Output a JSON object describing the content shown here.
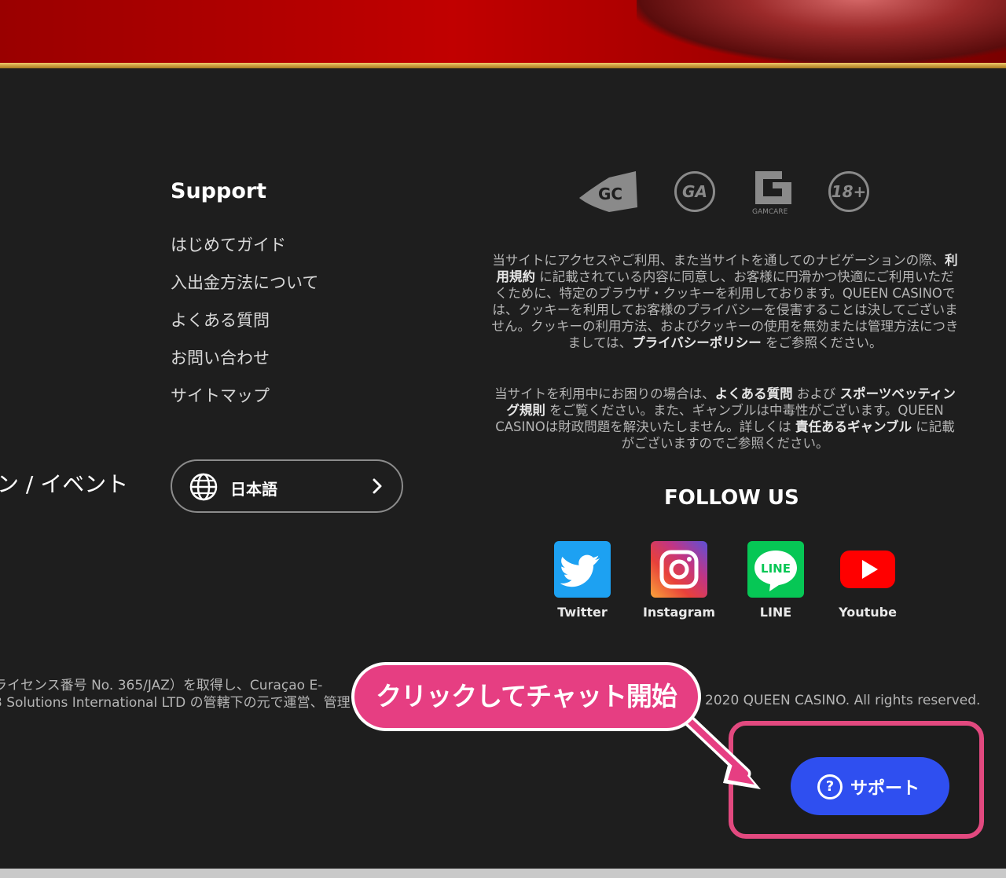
{
  "support": {
    "title": "Support",
    "links": [
      "はじめてガイド",
      "入出金方法について",
      "よくある質問",
      "お問い合わせ",
      "サイトマップ"
    ]
  },
  "left_partial_text": "ン / イベント",
  "language": {
    "label": "日本語",
    "icon": "globe-icon"
  },
  "badges": [
    {
      "icon": "gc-badge-icon",
      "text": "GC"
    },
    {
      "icon": "ga-badge-icon",
      "text": "GA"
    },
    {
      "icon": "gamcare-badge-icon",
      "text": "GAMCARE"
    },
    {
      "icon": "age-18-badge-icon",
      "text": "18+"
    }
  ],
  "legal": {
    "p1_a": "当サイトにアクセスやご利用、また当サイトを通してのナビゲーションの際、",
    "p1_b": "利用規約",
    "p1_c": " に記載されている内容に同意し、お客様に円滑かつ快適にご利用いただくために、特定のブラウザ・クッキーを利用しております。QUEEN CASINOでは、クッキーを利用してお客様のプライバシーを侵害することは決してございません。クッキーの利用方法、およびクッキーの使用を無効または管理方法につきましては、",
    "p1_d": "プライバシーポリシー",
    "p1_e": " をご参照ください。",
    "p2_a": "当サイトを利用中にお困りの場合は、",
    "p2_b": "よくある質問",
    "p2_c": " および ",
    "p2_d": "スポーツベッティング規則",
    "p2_e": " をご覧ください。また、ギャンブルは中毒性がございます。QUEEN CASINOは財政問題を解決いたしません。詳しくは ",
    "p2_f": "責任あるギャンブル",
    "p2_g": " に記載がございますのでご参照ください。"
  },
  "follow": {
    "title": "FOLLOW US",
    "items": [
      {
        "label": "Twitter",
        "icon": "twitter-icon",
        "color": "#1da1f2"
      },
      {
        "label": "Instagram",
        "icon": "instagram-icon",
        "color": "#c13584"
      },
      {
        "label": "LINE",
        "icon": "line-icon",
        "color": "#06c755"
      },
      {
        "label": "Youtube",
        "icon": "youtube-icon",
        "color": "#ff0000"
      }
    ]
  },
  "footer": {
    "license_line1": "ライセンス番号 No. 365/JAZ）を取得し、Curaçao E-",
    "license_line2": "3 Solutions International LTD の管轄下の元で運営、管理",
    "copyright": "2020 QUEEN CASINO. All rights reserved."
  },
  "callout": {
    "text": "クリックしてチャット開始",
    "color": "#e63e82"
  },
  "support_button": {
    "label": "サポート",
    "icon": "question-icon",
    "icon_text": "?",
    "color": "#2f4ff0"
  }
}
